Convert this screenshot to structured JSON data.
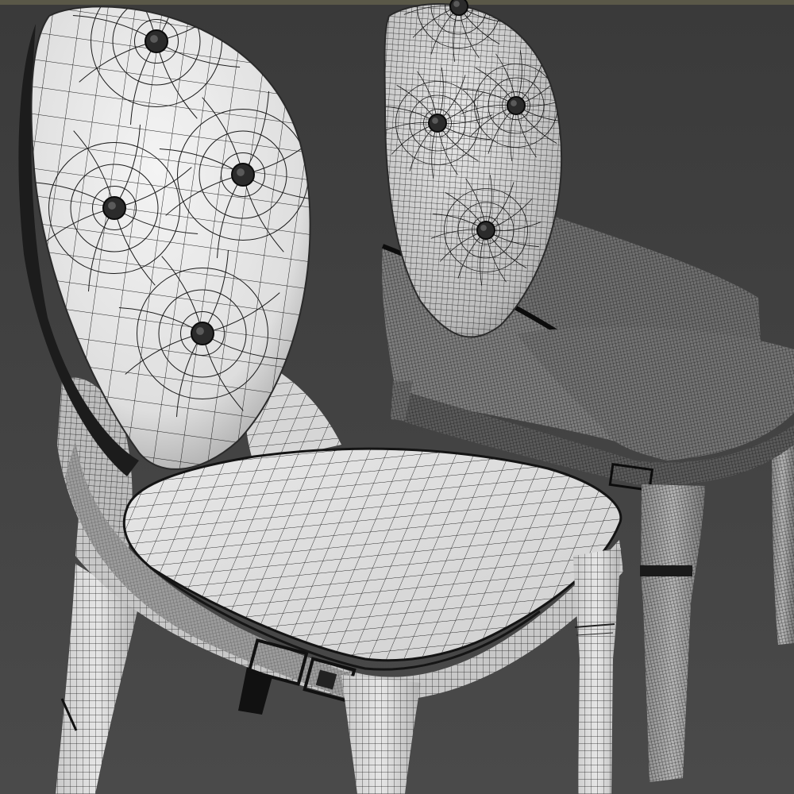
{
  "scene": {
    "background_top": "#3a3a3a",
    "background_bottom": "#4a4a4a",
    "top_bar_color": "#5a5848",
    "front_shell": "#e9e9e9",
    "front_shadow": "#9a9a9a",
    "rear_shell": "#d4d4d4",
    "rear_shadow": "#5c5c5c",
    "wire_light": "#1b1b1b",
    "wire_dense": "#101010",
    "objects": [
      {
        "name": "front-chair",
        "backrest_buttons": 4
      },
      {
        "name": "rear-chair",
        "backrest_buttons": 4
      }
    ]
  }
}
